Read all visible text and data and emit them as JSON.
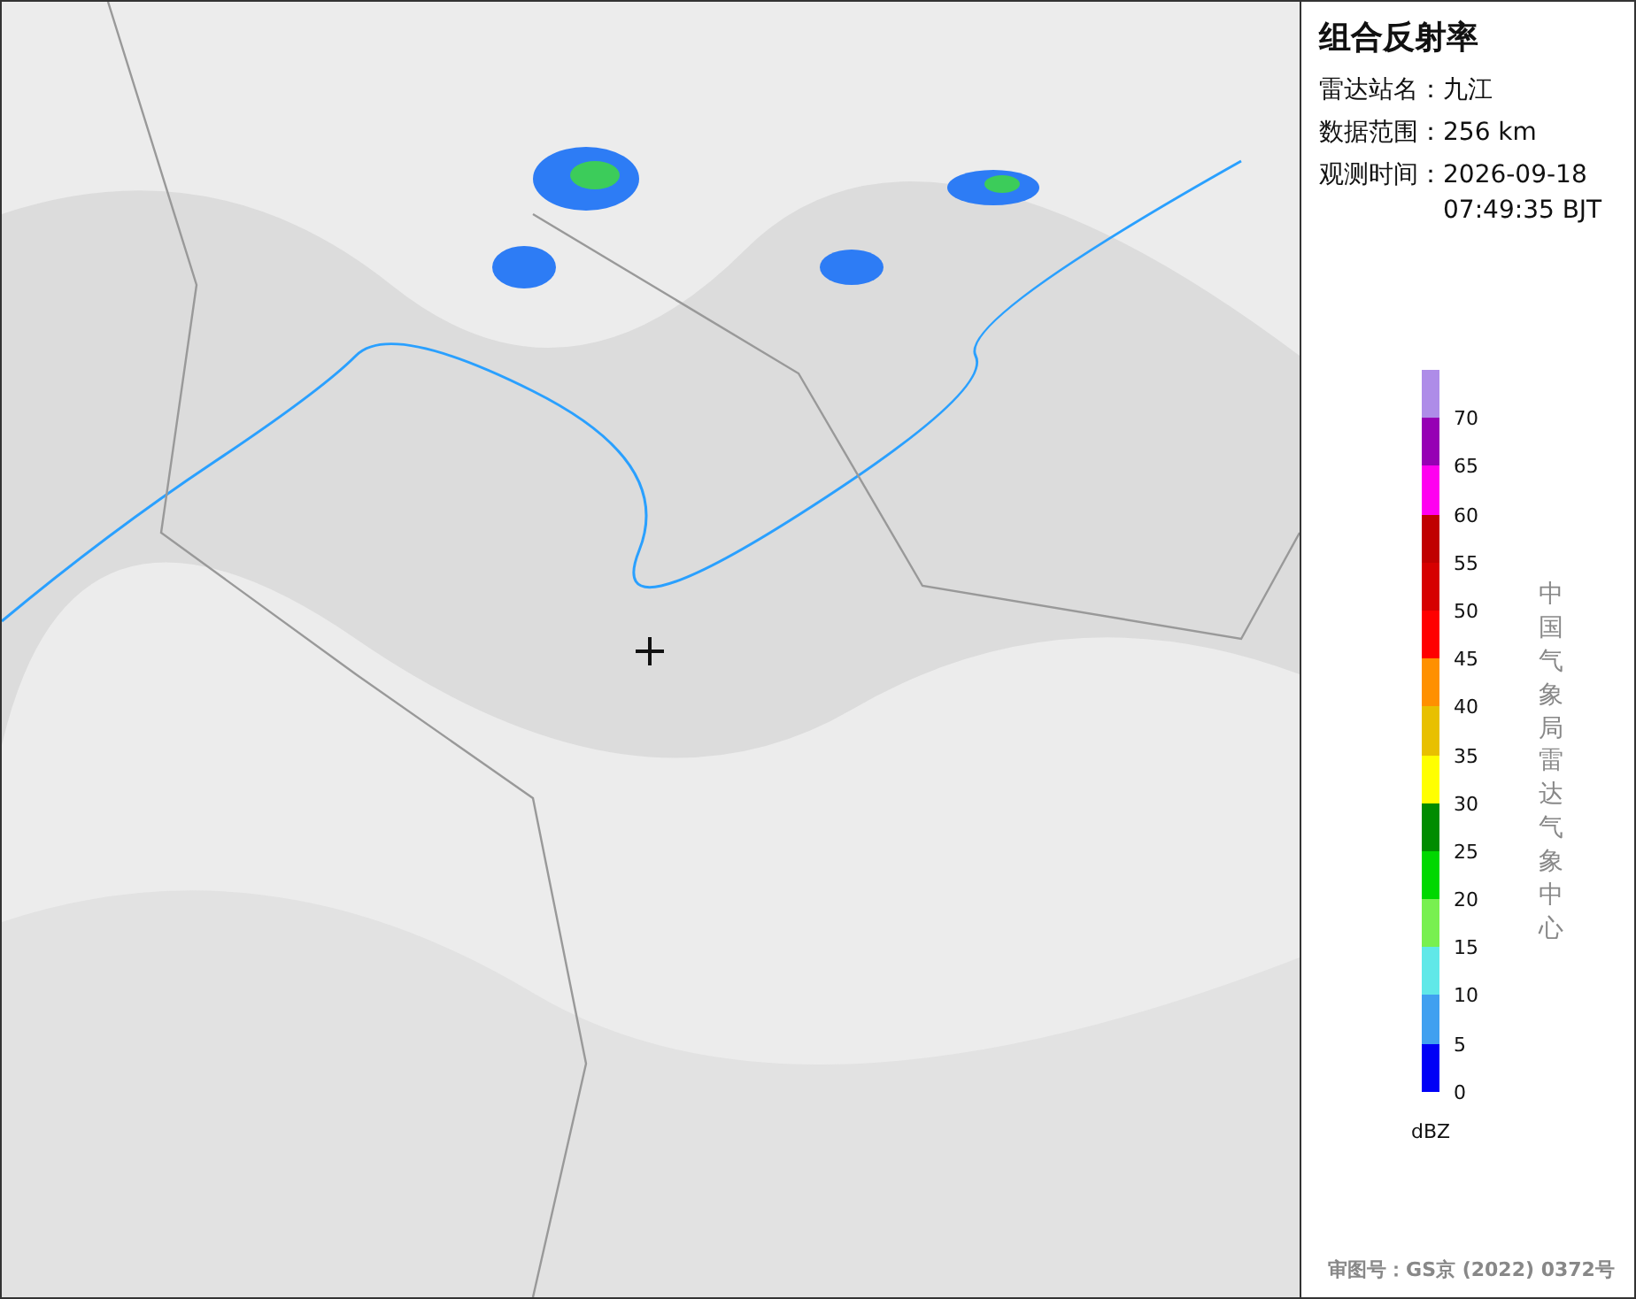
{
  "title": "组合反射率",
  "info": [
    {
      "label": "雷达站名：",
      "value": "九江"
    },
    {
      "label": "数据范围：",
      "value": "256 km"
    },
    {
      "label": "观测时间：",
      "value": "2026-09-18 07:49:35 BJT"
    }
  ],
  "legend": {
    "unit": "dBZ",
    "bins": [
      {
        "color": "#ae8ce8",
        "label": "70"
      },
      {
        "color": "#9600b4",
        "label": "65"
      },
      {
        "color": "#ff00f0",
        "label": "60"
      },
      {
        "color": "#c00000",
        "label": "55"
      },
      {
        "color": "#d60000",
        "label": "50"
      },
      {
        "color": "#ff0000",
        "label": "45"
      },
      {
        "color": "#ff9000",
        "label": "40"
      },
      {
        "color": "#e8c000",
        "label": "35"
      },
      {
        "color": "#ffff00",
        "label": "30"
      },
      {
        "color": "#008c00",
        "label": "25"
      },
      {
        "color": "#00d800",
        "label": "20"
      },
      {
        "color": "#78f050",
        "label": "15"
      },
      {
        "color": "#60e8e8",
        "label": "10"
      },
      {
        "color": "#40a0f0",
        "label": "5"
      },
      {
        "color": "#0000f6",
        "label": "0"
      }
    ]
  },
  "credit": "中国气象局雷达气象中心",
  "approval": "审图号：GS京 (2022) 0372号"
}
